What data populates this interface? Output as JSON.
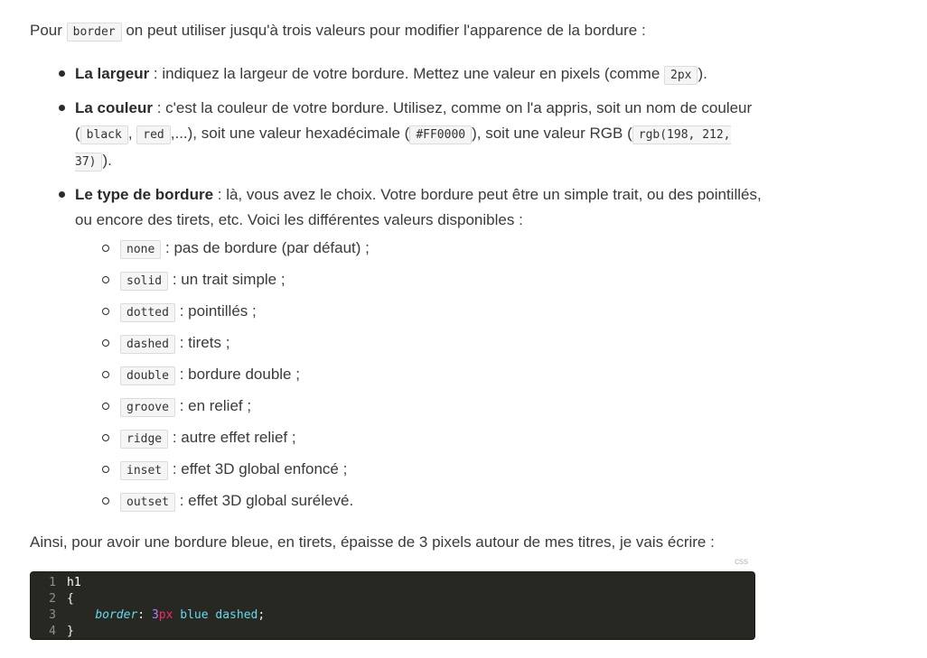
{
  "intro": {
    "before": "Pour ",
    "code": "border",
    "after": " on peut utiliser jusqu'à trois valeurs pour modifier l'apparence de la bordure :"
  },
  "list": {
    "largeur": {
      "title": "La largeur",
      "text1": " : indiquez la largeur de votre bordure. Mettez une valeur en pixels (comme ",
      "code": "2px",
      "text2": ")."
    },
    "couleur": {
      "title": "La couleur",
      "text1": " : c'est la couleur de votre bordure. Utilisez, comme on l'a appris, soit un nom de couleur (",
      "code1": "black",
      "sep": ", ",
      "code2": "red",
      "text2": ",...), soit une valeur hexadécimale (",
      "code3": "#FF0000",
      "text3": "), soit une valeur RGB (",
      "code4": "rgb(198, 212, 37)",
      "text4": ")."
    },
    "type": {
      "title": "Le type de bordure",
      "text": " : là, vous avez le choix. Votre bordure peut être un simple trait, ou des pointillés, ou encore des tirets, etc. Voici les différentes valeurs disponibles :",
      "values": [
        {
          "code": "none",
          "desc": " : pas de bordure (par défaut) ;"
        },
        {
          "code": "solid",
          "desc": " : un trait simple ;"
        },
        {
          "code": "dotted",
          "desc": " : pointillés ;"
        },
        {
          "code": "dashed",
          "desc": " : tirets ;"
        },
        {
          "code": "double",
          "desc": " : bordure double ;"
        },
        {
          "code": "groove",
          "desc": " : en relief ;"
        },
        {
          "code": "ridge",
          "desc": " : autre effet relief ;"
        },
        {
          "code": "inset",
          "desc": " : effet 3D global enfoncé ;"
        },
        {
          "code": "outset",
          "desc": " : effet 3D global surélevé."
        }
      ]
    }
  },
  "conclusion": "Ainsi, pour avoir une bordure bleue, en tirets, épaisse de 3 pixels autour de mes titres, je vais écrire :",
  "code_block": {
    "language": "css",
    "lines": [
      {
        "num": "1",
        "selector": "h1"
      },
      {
        "num": "2",
        "punc": "{"
      },
      {
        "num": "3",
        "property": "border",
        "colon": ": ",
        "number": "3",
        "unit": "px",
        "value": " blue dashed",
        "end": ";"
      },
      {
        "num": "4",
        "punc": "}"
      }
    ]
  }
}
